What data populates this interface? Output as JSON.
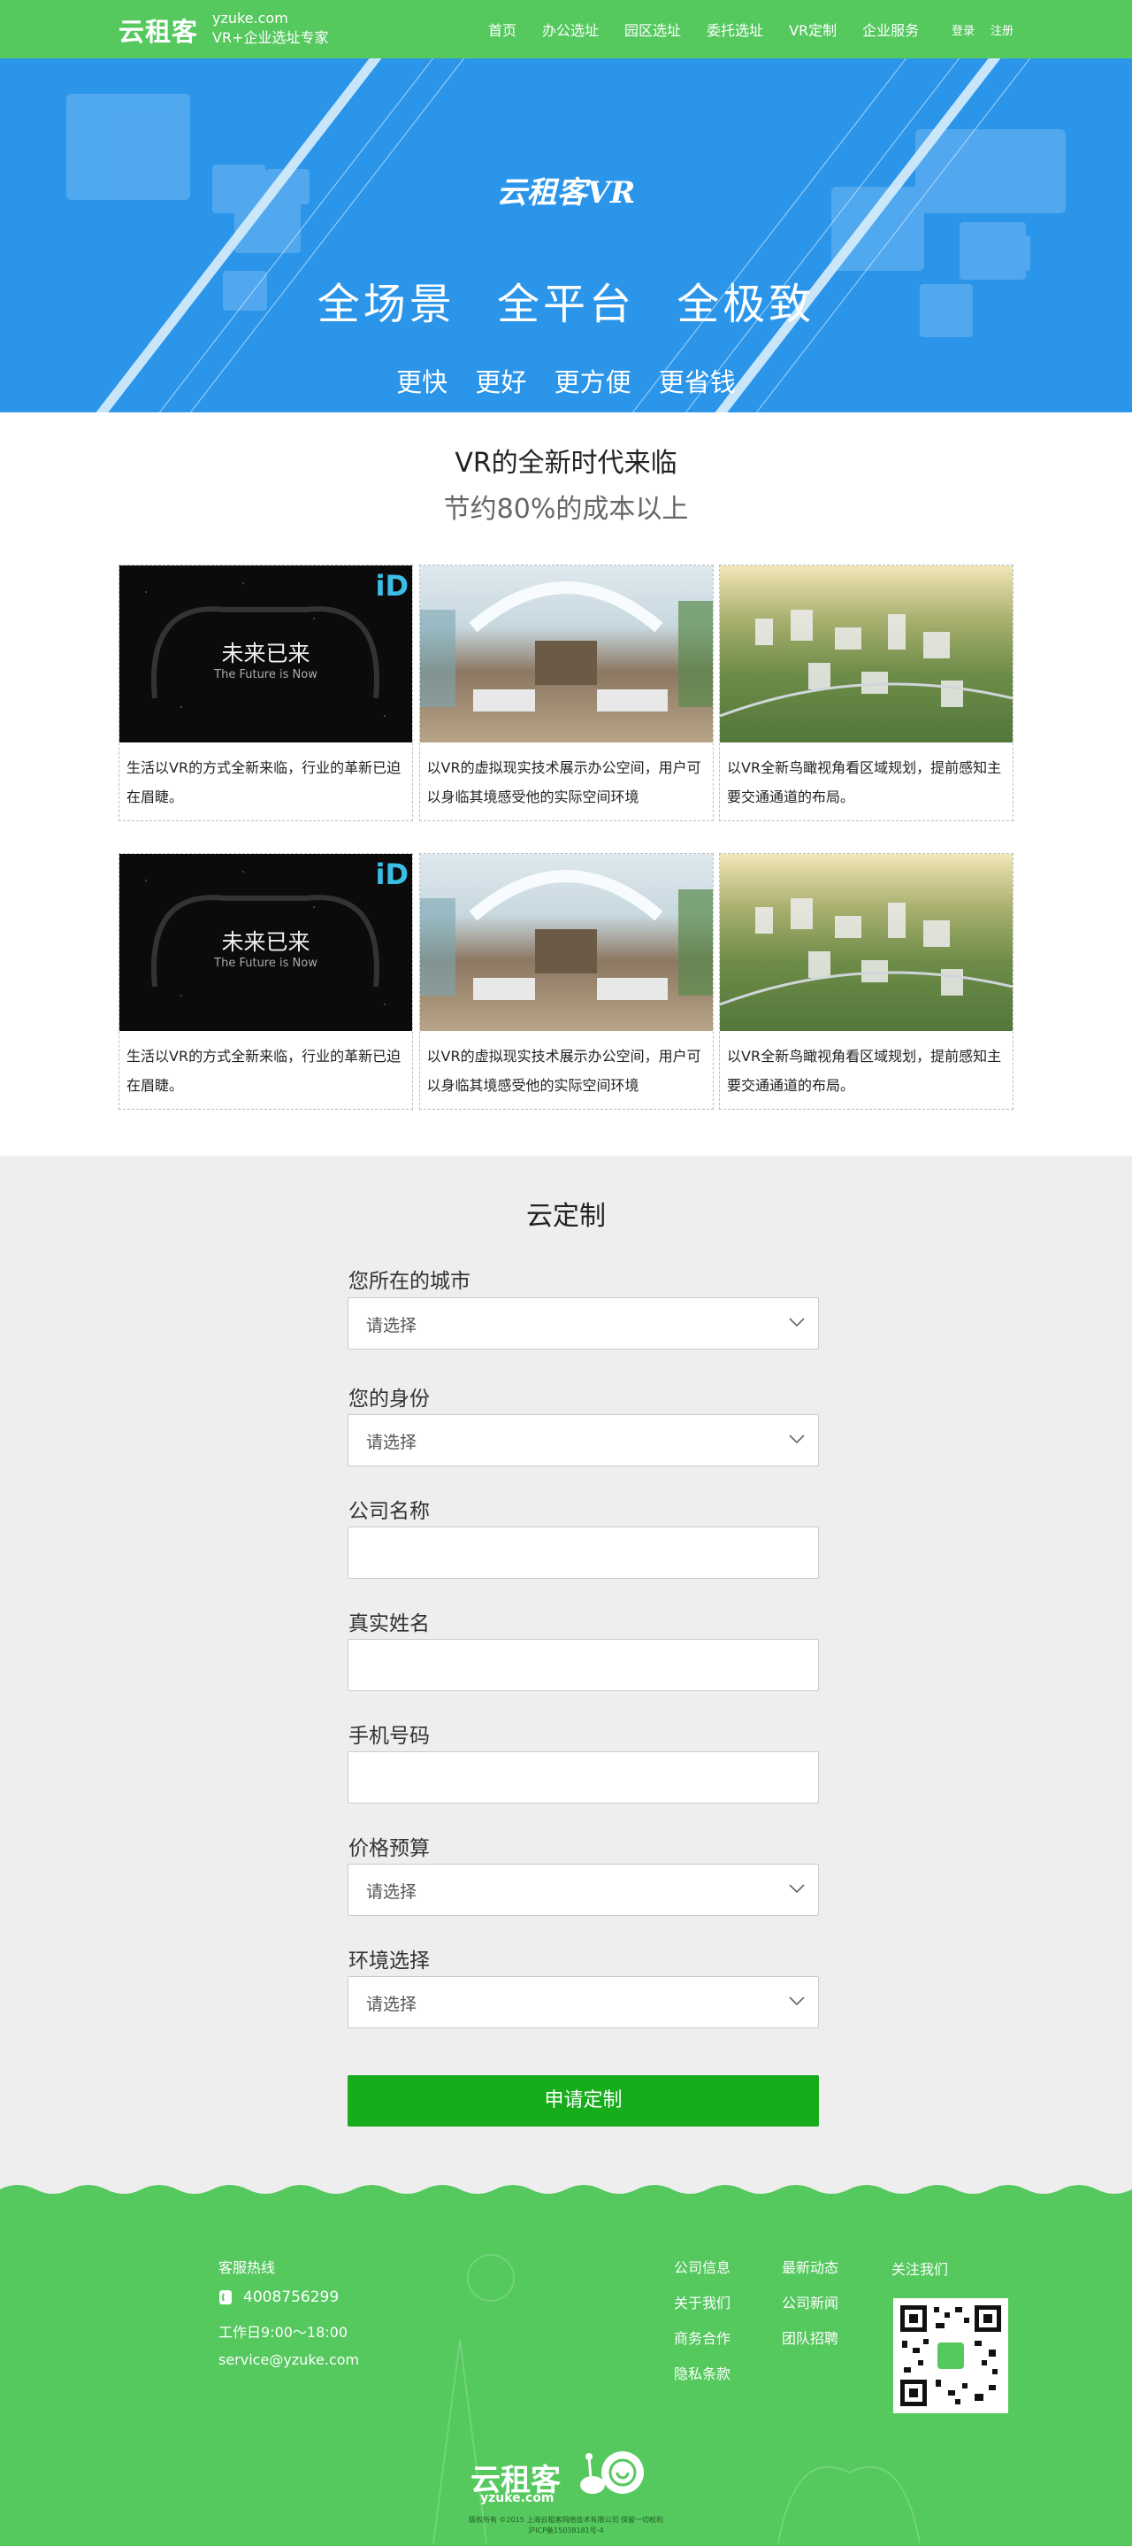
{
  "header": {
    "logo": "云租客",
    "domain": "yzuke.com",
    "tagline": "VR+企业选址专家",
    "nav": [
      "首页",
      "办公选址",
      "园区选址",
      "委托选址",
      "VR定制",
      "企业服务"
    ],
    "login": "登录",
    "register": "注册"
  },
  "banner": {
    "brand": "云租客VR",
    "slogan": "全场景  全平台  全极致",
    "subslogan": "更快  更好  更方便  更省钱"
  },
  "intro": {
    "title": "VR的全新时代来临",
    "subtitle": "节约80%的成本以上",
    "future_cn": "未来已来",
    "future_en": "The Future is Now",
    "id_logo": "iD",
    "rows": [
      [
        {
          "image": "future-is-now",
          "text": "生活以VR的方式全新来临，行业的革新已迫在眉睫。"
        },
        {
          "image": "office-space",
          "text": "以VR的虚拟现实技术展示办公空间，用户可以身临其境感受他的实际空间环境"
        },
        {
          "image": "city-aerial",
          "text": "以VR全新鸟瞰视角看区域规划，提前感知主要交通通道的布局。"
        }
      ],
      [
        {
          "image": "future-is-now",
          "text": "生活以VR的方式全新来临，行业的革新已迫在眉睫。"
        },
        {
          "image": "office-space",
          "text": "以VR的虚拟现实技术展示办公空间，用户可以身临其境感受他的实际空间环境"
        },
        {
          "image": "city-aerial",
          "text": "以VR全新鸟瞰视角看区域规划，提前感知主要交通通道的布局。"
        }
      ]
    ]
  },
  "custom": {
    "title": "云定制",
    "fields": [
      {
        "label": "您所在的城市",
        "type": "select",
        "value": "请选择"
      },
      {
        "label": "您的身份",
        "type": "select",
        "value": "请选择"
      },
      {
        "label": "公司名称",
        "type": "text",
        "value": ""
      },
      {
        "label": "真实姓名",
        "type": "text",
        "value": ""
      },
      {
        "label": "手机号码",
        "type": "text",
        "value": ""
      },
      {
        "label": "价格预算",
        "type": "select",
        "value": "请选择"
      },
      {
        "label": "环境选择",
        "type": "select",
        "value": "请选择"
      }
    ],
    "submit": "申请定制"
  },
  "footer": {
    "hotline_title": "客服热线",
    "phone": "4008756299",
    "hours": "工作日9:00～18:00",
    "email": "service@yzuke.com",
    "col1": [
      "公司信息",
      "关于我们",
      "商务合作",
      "隐私条款"
    ],
    "col2": [
      "最新动态",
      "公司新闻",
      "团队招聘"
    ],
    "follow": "关注我们",
    "brand": "云租客",
    "brand_sub": "yzuke.com",
    "copyright": "版权所有 ©2015 上海云租客网络技术有限公司 保留一切权利",
    "icp": "沪ICP备15038181号-4"
  },
  "colors": {
    "header_green": "#55c85e",
    "banner_blue": "#2b95ea",
    "button_green": "#16ac1b",
    "form_bg": "#eeeeee"
  }
}
